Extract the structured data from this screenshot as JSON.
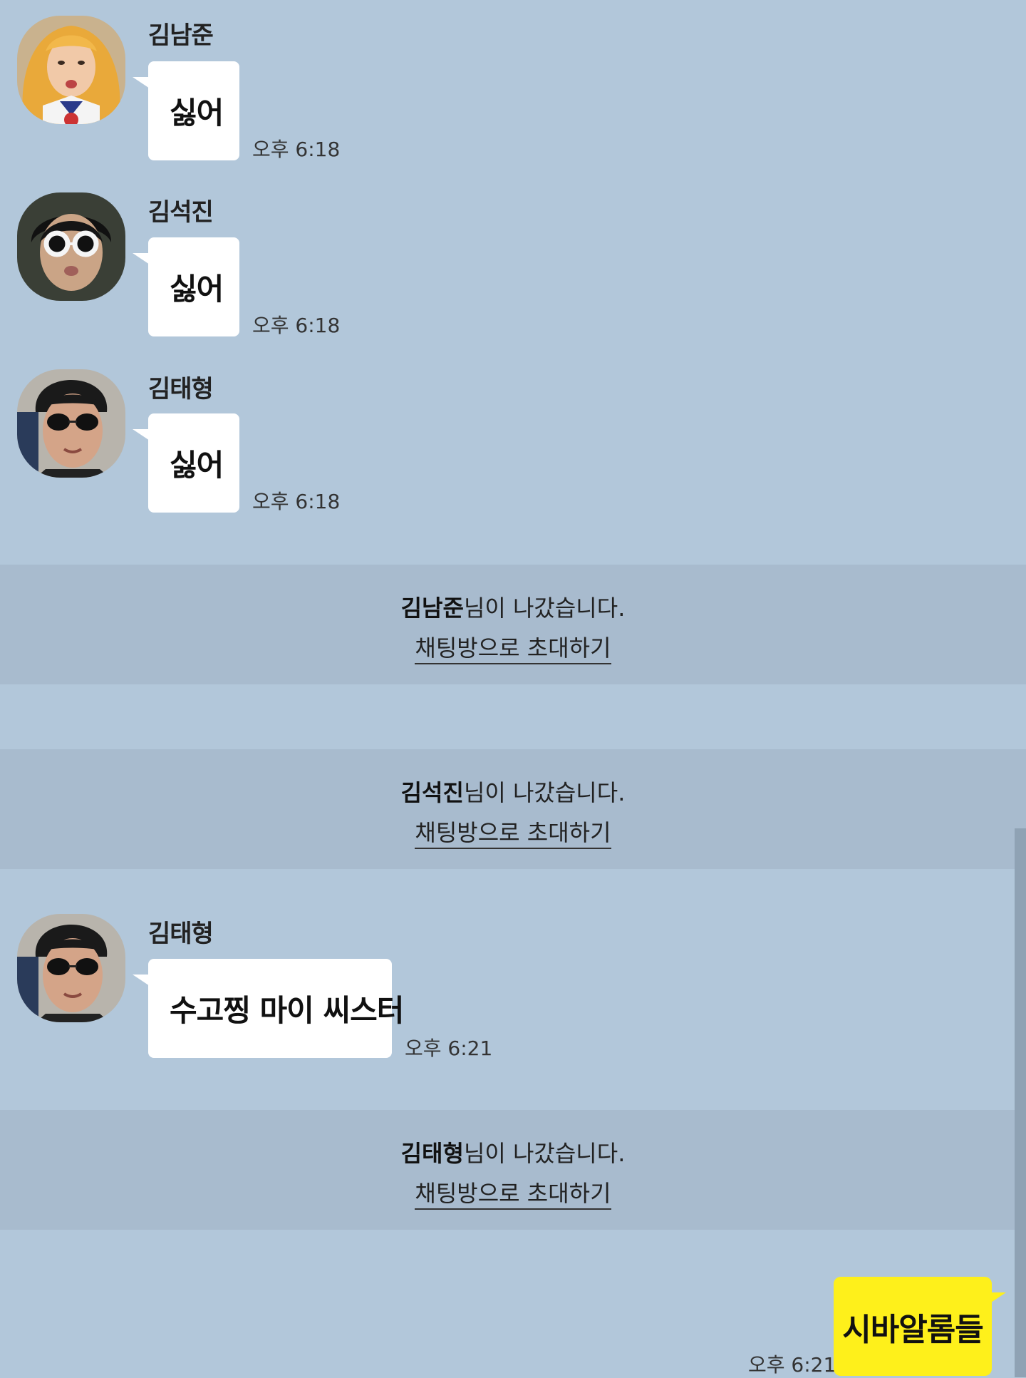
{
  "messages": [
    {
      "sender": "김남준",
      "text": "싫어",
      "time": "오후 6:18"
    },
    {
      "sender": "김석진",
      "text": "싫어",
      "time": "오후 6:18"
    },
    {
      "sender": "김태형",
      "text": "싫어",
      "time": "오후 6:18"
    },
    {
      "sender": "김태형",
      "text": "수고찡 마이 씨스터",
      "time": "오후 6:21"
    }
  ],
  "notices": [
    {
      "name": "김남준",
      "suffix": "님이 나갔습니다.",
      "link": "채팅방으로 초대하기"
    },
    {
      "name": "김석진",
      "suffix": "님이 나갔습니다.",
      "link": "채팅방으로 초대하기"
    },
    {
      "name": "김태형",
      "suffix": "님이 나갔습니다.",
      "link": "채팅방으로 초대하기"
    }
  ],
  "my_message": {
    "text": "시바알롬들",
    "time": "오후 6:21"
  },
  "colors": {
    "background": "#b2c7da",
    "notice_band": "#a8bbce",
    "other_bubble": "#ffffff",
    "my_bubble": "#fef01b"
  },
  "icons": {
    "avatar_1": "avatar-blonde-wig",
    "avatar_2": "avatar-white-round-glasses",
    "avatar_3": "avatar-dark-round-sunglasses"
  }
}
